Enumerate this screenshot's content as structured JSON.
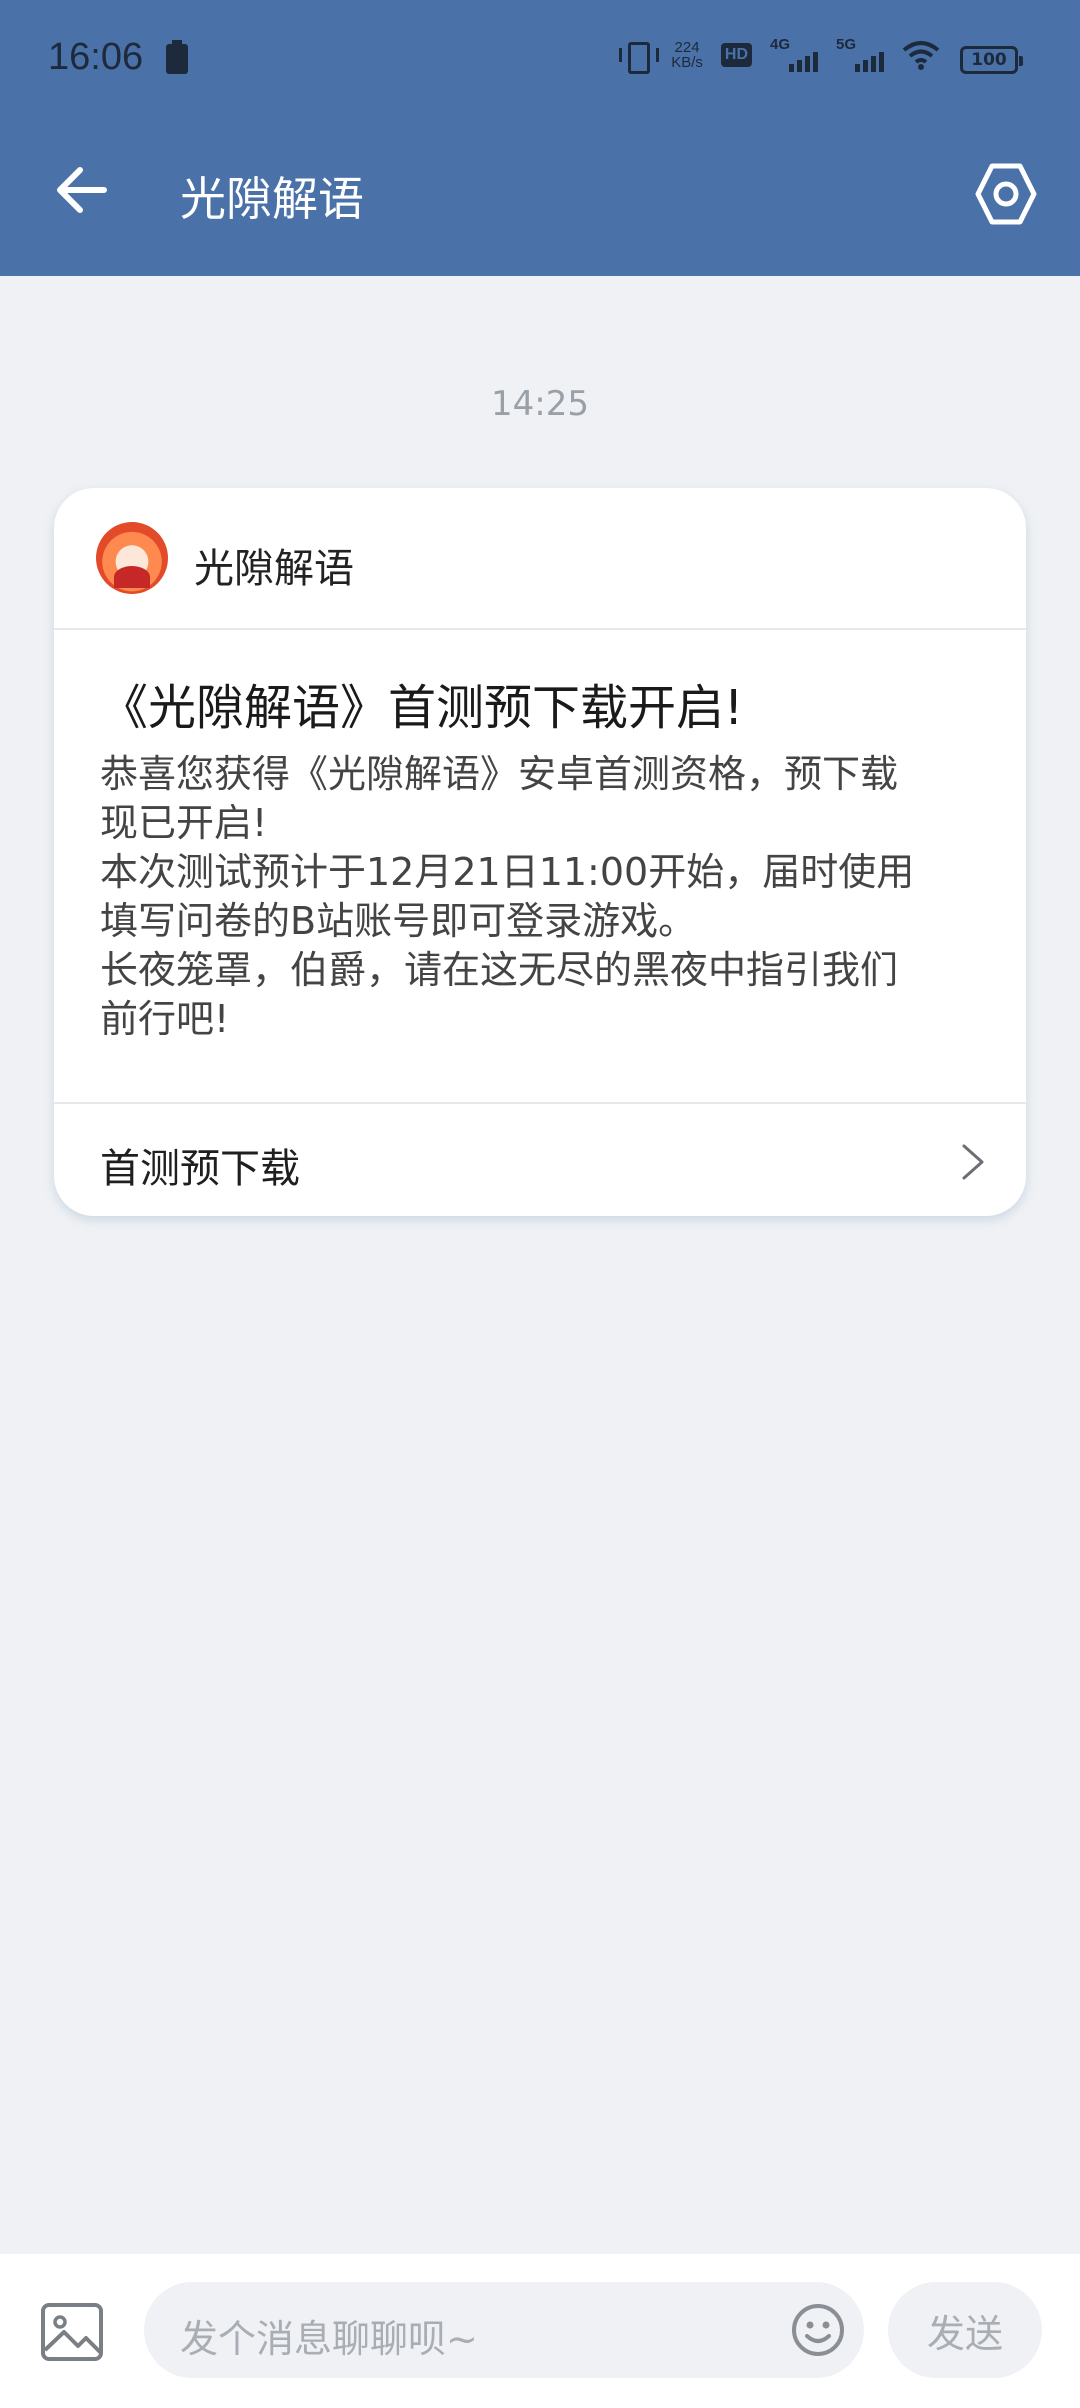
{
  "status_bar": {
    "time": "16:06",
    "speed_top": "224",
    "speed_unit": "KB/s",
    "hd": "HD",
    "net1": "4G",
    "net2": "5G",
    "battery": "100"
  },
  "header": {
    "title": "光隙解语",
    "back_icon": "arrow-left-icon",
    "settings_icon": "settings-icon",
    "bg_color": "#4a71a8"
  },
  "conversation": {
    "timestamp": "14:25",
    "card": {
      "sender": "光隙解语",
      "title": "《光隙解语》首测预下载开启!",
      "lines": [
        "恭喜您获得《光隙解语》安卓首测资格，预下载",
        "现已开启!",
        "本次测试预计于12月21日11:00开始，届时使用",
        "填写问卷的B站账号即可登录游戏。",
        "长夜笼罩，伯爵，请在这无尽的黑夜中指引我们",
        "前行吧!"
      ],
      "action_label": "首测预下载"
    }
  },
  "input_bar": {
    "placeholder": "发个消息聊聊呗~",
    "send_label": "发送"
  }
}
